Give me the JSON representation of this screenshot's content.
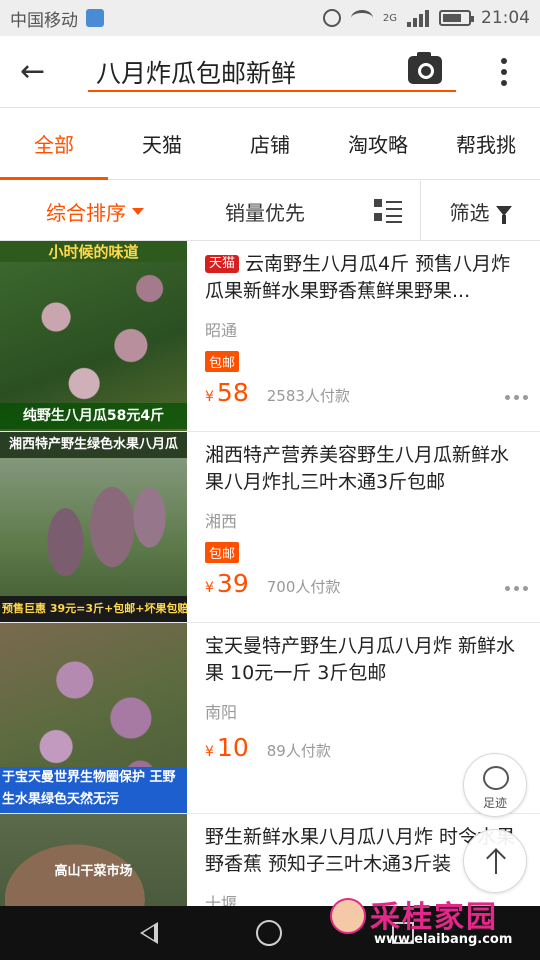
{
  "status_bar": {
    "carrier": "中国移动",
    "network": "2G",
    "time": "21:04",
    "battery_level": 0.75,
    "icons": [
      "notification-icon",
      "alarm-icon",
      "wifi-icon",
      "signal-icon",
      "battery-icon"
    ]
  },
  "header": {
    "query": "八月炸瓜包邮新鲜",
    "icons": [
      "back-arrow-icon",
      "camera-icon",
      "more-vertical-icon"
    ],
    "accent": "#ff5000"
  },
  "tabs": [
    {
      "label": "全部",
      "active": true
    },
    {
      "label": "天猫",
      "active": false
    },
    {
      "label": "店铺",
      "active": false
    },
    {
      "label": "淘攻略",
      "active": false
    },
    {
      "label": "帮我挑",
      "active": false
    }
  ],
  "sort": {
    "main": "综合排序",
    "sales": "销量优先",
    "filter": "筛选"
  },
  "products": [
    {
      "tmall_tag": "天猫",
      "title": "云南野生八月瓜4斤 预售八月炸瓜果新鲜水果野香蕉鲜果野果...",
      "location": "昭通",
      "shipping": "包邮",
      "currency": "¥",
      "price": "58",
      "paid": "2583人付款",
      "thumb_top": "小时候的味道",
      "thumb_bottom": "纯野生八月瓜58元4斤"
    },
    {
      "title": "湘西特产营养美容野生八月瓜新鲜水果八月炸扎三叶木通3斤包邮",
      "location": "湘西",
      "shipping": "包邮",
      "currency": "¥",
      "price": "39",
      "paid": "700人付款",
      "thumb_top": "湘西特产野生绿色水果八月瓜",
      "thumb_bottom": "预售巨惠 39元=3斤+包邮+坏果包赔"
    },
    {
      "title": "宝天曼特产野生八月瓜八月炸 新鲜水果 10元一斤 3斤包邮",
      "location": "南阳",
      "currency": "¥",
      "price": "10",
      "paid": "89人付款",
      "thumb_bottom": "于宝天曼世界生物圈保护 王野生水果绿色天然无污"
    },
    {
      "title": "野生新鲜水果八月瓜八月炸 时令水果野香蕉 预知子三叶木通3斤装",
      "location": "十堰",
      "thumb_mid": "高山干菜市场"
    }
  ],
  "floating": {
    "footprint_label": "足迹"
  },
  "watermark": {
    "text": "采桂家园",
    "url": "www.elaibang.com"
  }
}
